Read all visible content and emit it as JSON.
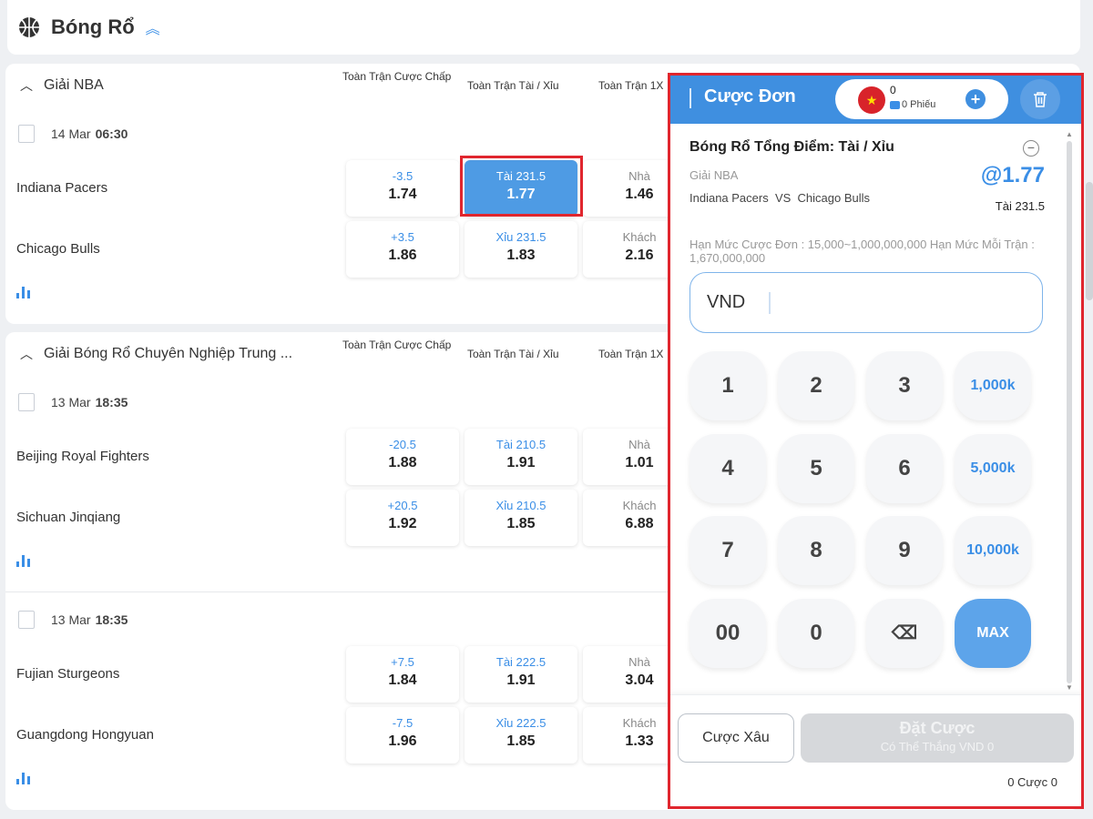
{
  "sport": {
    "title": "Bóng Rổ",
    "icon": "basketball-icon",
    "collapse_icon": "chevron-up-double-icon"
  },
  "leagues": [
    {
      "name": "Giải NBA",
      "columns": [
        "Toàn Trận Cược Chấp",
        "Toàn Trận Tài / Xỉu",
        "Toàn Trận 1X"
      ],
      "matches": [
        {
          "date": "14 Mar",
          "time": "06:30",
          "home": "Indiana Pacers",
          "away": "Chicago Bulls",
          "hdp": [
            {
              "line": "-3.5",
              "odd": "1.74"
            },
            {
              "line": "+3.5",
              "odd": "1.86"
            }
          ],
          "ou": [
            {
              "line": "Tài 231.5",
              "odd": "1.77"
            },
            {
              "line": "Xỉu 231.5",
              "odd": "1.83"
            }
          ],
          "x12": [
            {
              "line": "Nhà",
              "odd": "1.46"
            },
            {
              "line": "Khách",
              "odd": "2.16"
            }
          ]
        }
      ]
    },
    {
      "name": "Giải Bóng Rổ Chuyên Nghiệp Trung ...",
      "columns": [
        "Toàn Trận Cược Chấp",
        "Toàn Trận Tài / Xỉu",
        "Toàn Trận 1X"
      ],
      "matches": [
        {
          "date": "13 Mar",
          "time": "18:35",
          "home": "Beijing Royal Fighters",
          "away": "Sichuan Jinqiang",
          "hdp": [
            {
              "line": "-20.5",
              "odd": "1.88"
            },
            {
              "line": "+20.5",
              "odd": "1.92"
            }
          ],
          "ou": [
            {
              "line": "Tài 210.5",
              "odd": "1.91"
            },
            {
              "line": "Xỉu 210.5",
              "odd": "1.85"
            }
          ],
          "x12": [
            {
              "line": "Nhà",
              "odd": "1.01"
            },
            {
              "line": "Khách",
              "odd": "6.88"
            }
          ]
        },
        {
          "date": "13 Mar",
          "time": "18:35",
          "home": "Fujian Sturgeons",
          "away": "Guangdong Hongyuan",
          "hdp": [
            {
              "line": "+7.5",
              "odd": "1.84"
            },
            {
              "line": "-7.5",
              "odd": "1.96"
            }
          ],
          "ou": [
            {
              "line": "Tài 222.5",
              "odd": "1.91"
            },
            {
              "line": "Xỉu 222.5",
              "odd": "1.85"
            }
          ],
          "x12": [
            {
              "line": "Nhà",
              "odd": "3.04"
            },
            {
              "line": "Khách",
              "odd": "1.33"
            }
          ]
        }
      ]
    }
  ],
  "betslip": {
    "title": "Cược Đơn",
    "count": "0",
    "tickets": "0 Phiếu",
    "bet_title": "Bóng Rổ Tổng Điểm: Tài / Xỉu",
    "league": "Giải NBA",
    "odds": "@1.77",
    "home": "Indiana Pacers",
    "vs": "VS",
    "away": "Chicago Bulls",
    "pick": "Tài 231.5",
    "limits": "Hạn Mức Cược Đơn : 15,000~1,000,000,000 Hạn Mức Mỗi Trận : 1,670,000,000",
    "currency": "VND",
    "keypad": [
      "1",
      "2",
      "3",
      "1,000k",
      "4",
      "5",
      "6",
      "5,000k",
      "7",
      "8",
      "9",
      "10,000k",
      "00",
      "0",
      "⌫",
      "MAX"
    ],
    "parlay_label": "Cược Xâu",
    "place_label": "Đặt Cược",
    "win_label": "Có Thể Thắng VND 0",
    "bet_count": "0 Cược 0"
  },
  "colors": {
    "accent": "#3f8fe0",
    "highlight": "#e0262e",
    "selected": "#4e9be4"
  }
}
